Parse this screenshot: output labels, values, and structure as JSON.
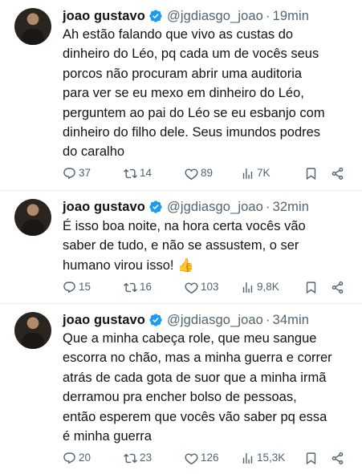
{
  "tweets": [
    {
      "name": "joao gustavo",
      "handle": "@jgdiasgo_joao",
      "separator": "·",
      "time": "19min",
      "text": "Ah estão falando que vivo as custas do\ndinheiro do Léo, pq cada um de vocês seus\nporcos não procuram abrir uma auditoria\npara ver se eu mexo em dinheiro do Léo,\nperguntem ao pai do Léo se eu esbanjo com\ndinheiro do filho dele. Seus imundos podres\ndo caralho",
      "replies": "37",
      "retweets": "14",
      "likes": "89",
      "views": "7K"
    },
    {
      "name": "joao gustavo",
      "handle": "@jgdiasgo_joao",
      "separator": "·",
      "time": "32min",
      "text": "É isso boa noite, na hora certa vocês vão\nsaber de tudo, e não se assustem, o ser\nhumano virou isso! 👍",
      "replies": "15",
      "retweets": "16",
      "likes": "103",
      "views": "9,8K"
    },
    {
      "name": "joao gustavo",
      "handle": "@jgdiasgo_joao",
      "separator": "·",
      "time": "34min",
      "text": "Que a minha cabeça role, que meu sangue\nescorra no chão, mas a minha guerra e correr\natrás de cada gota de suor que a minha irmã\nderramou pra encher bolso de pessoas,\nentão esperem que vocês vão saber pq essa\né minha guerra",
      "replies": "20",
      "retweets": "23",
      "likes": "126",
      "views": "15,3K"
    }
  ],
  "icons": {
    "reply": "reply-icon",
    "retweet": "retweet-icon",
    "like": "heart-icon",
    "views": "views-icon",
    "bookmark": "bookmark-icon",
    "share": "share-icon",
    "verified": "verified-badge-icon"
  },
  "colors": {
    "text": "#0f1419",
    "secondary": "#536471",
    "verified": "#1d9bf0",
    "divider": "#e6ecf0"
  }
}
